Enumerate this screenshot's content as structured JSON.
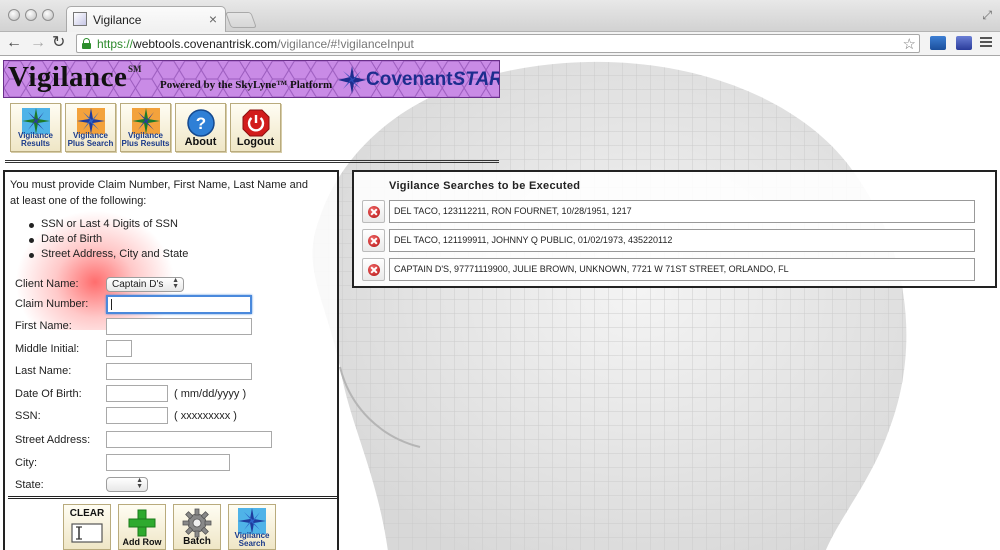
{
  "browser": {
    "tab_title": "Vigilance",
    "url_scheme": "https://",
    "url_host": "webtools.covenantrisk.com",
    "url_path": "/vigilance/#!vigilanceInput"
  },
  "banner": {
    "brand": "Vigilance",
    "brand_mark": "SM",
    "powered_by": "Powered by the SkyLyne™ Platform",
    "partner_a": "Covenant",
    "partner_b": "STAR"
  },
  "nav_buttons": [
    {
      "label": "Vigilance Results"
    },
    {
      "label": "Vigilance Plus Search"
    },
    {
      "label": "Vigilance Plus Results"
    },
    {
      "label": "About"
    },
    {
      "label": "Logout"
    }
  ],
  "form": {
    "instructions": "You must provide Claim Number, First Name, Last Name and at least one of the following:",
    "requirements": [
      "SSN or Last 4 Digits of SSN",
      "Date of Birth",
      "Street Address, City and State"
    ],
    "labels": {
      "client_name": "Client Name:",
      "claim_number": "Claim Number:",
      "first_name": "First Name:",
      "middle_initial": "Middle Initial:",
      "last_name": "Last Name:",
      "dob": "Date Of Birth:",
      "ssn": "SSN:",
      "street": "Street Address:",
      "city": "City:",
      "state": "State:"
    },
    "client_name_value": "Captain D's",
    "dob_hint": "( mm/dd/yyyy )",
    "ssn_hint": "( xxxxxxxxx )",
    "state_value": ""
  },
  "actions": [
    {
      "label": "CLEAR"
    },
    {
      "label": "Add Row"
    },
    {
      "label": "Batch"
    },
    {
      "label": "Vigilance Search"
    }
  ],
  "queue": {
    "title": "Vigilance Searches to be Executed",
    "rows": [
      "DEL TACO, 123112211, RON FOURNET, 10/28/1951, 1217",
      "DEL TACO, 121199911, JOHNNY Q PUBLIC, 01/02/1973, 435220112",
      "CAPTAIN D'S, 97771119900, JULIE BROWN, UNKNOWN, 7721 W 71ST STREET, ORLANDO, FL"
    ]
  },
  "colors": {
    "banner_bg": "#c98be6",
    "covenant_blue": "#1d2d8e",
    "button_face": "#f6efd6",
    "delete_red": "#c41a1a"
  }
}
